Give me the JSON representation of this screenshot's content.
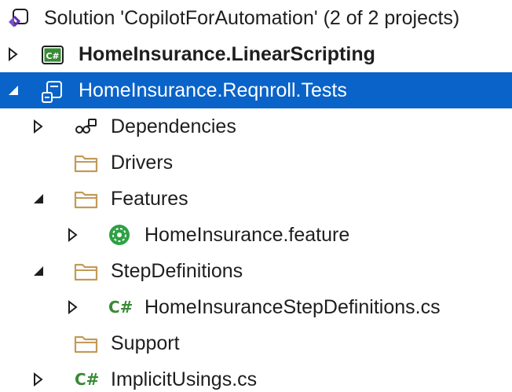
{
  "colors": {
    "selection": "#0a63c8",
    "folder": "#c29a58",
    "csharp_green": "#388a34",
    "text": "#1e1e1e"
  },
  "solution": {
    "label": "Solution 'CopilotForAutomation' (2 of 2 projects)",
    "icon": "solution-icon"
  },
  "projects": [
    {
      "label": "HomeInsurance.LinearScripting",
      "icon": "csharp-project-icon",
      "icon_text": "C#",
      "expanded": false,
      "bold": true
    },
    {
      "label": "HomeInsurance.Reqnroll.Tests",
      "icon": "test-project-icon",
      "expanded": true,
      "selected": true
    }
  ],
  "nodes": {
    "dependencies": {
      "label": "Dependencies",
      "icon": "dependencies-icon",
      "expanded": false
    },
    "drivers": {
      "label": "Drivers",
      "icon": "folder-icon"
    },
    "features": {
      "label": "Features",
      "icon": "folder-icon",
      "expanded": true
    },
    "feature_file": {
      "label": "HomeInsurance.feature",
      "icon": "reqnroll-feature-icon",
      "expanded": false
    },
    "step_definitions": {
      "label": "StepDefinitions",
      "icon": "folder-icon",
      "expanded": true
    },
    "step_file": {
      "label": "HomeInsuranceStepDefinitions.cs",
      "icon": "csharp-file-icon",
      "icon_text": "C#",
      "expanded": false
    },
    "support": {
      "label": "Support",
      "icon": "folder-icon"
    },
    "implicit_usings": {
      "label": "ImplicitUsings.cs",
      "icon": "csharp-file-icon",
      "icon_text": "C#",
      "expanded": false
    }
  }
}
